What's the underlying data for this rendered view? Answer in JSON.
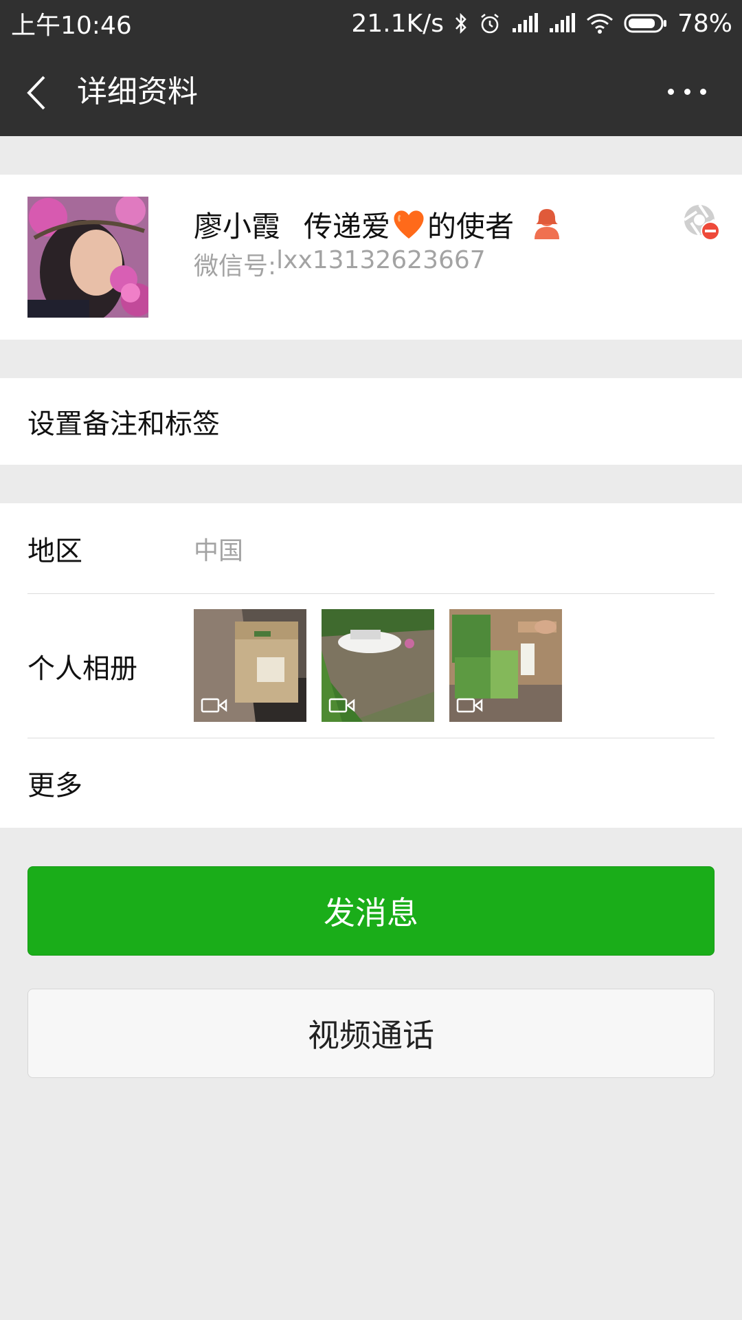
{
  "status_bar": {
    "time": "上午10:46",
    "net_speed": "21.1K/s",
    "battery": "78%"
  },
  "nav": {
    "title": "详细资料"
  },
  "profile": {
    "name": "廖小霞",
    "signature_before": "传递爱",
    "signature_after": "的使者",
    "wechat_id_label": "微信号: ",
    "wechat_id": "lxx13132623667",
    "accent_heart": "#ff6a1a",
    "gender_color": "#f07050"
  },
  "remark_row": {
    "label": "设置备注和标签"
  },
  "details": {
    "region_label": "地区",
    "region_value": "中国",
    "album_label": "个人相册",
    "album_thumbs": [
      "video-thumb-box",
      "video-thumb-car-river",
      "video-thumb-tea-box"
    ],
    "more_label": "更多"
  },
  "actions": {
    "send_message": "发消息",
    "video_call": "视频通话"
  },
  "colors": {
    "header_bg": "#303030",
    "page_bg": "#ebebeb",
    "primary_green": "#1aad19"
  }
}
